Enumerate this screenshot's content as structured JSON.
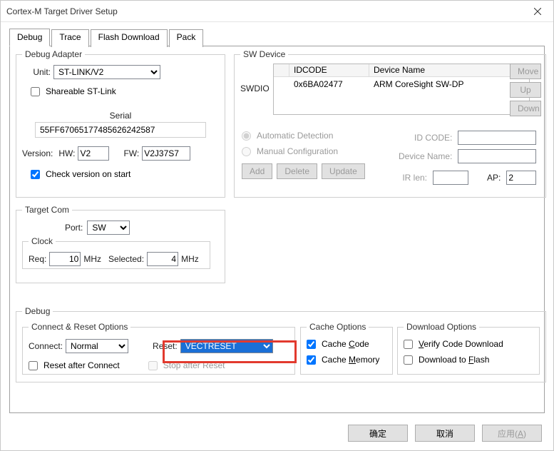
{
  "window": {
    "title": "Cortex-M Target Driver Setup"
  },
  "tabs": {
    "debug": "Debug",
    "trace": "Trace",
    "flash": "Flash Download",
    "pack": "Pack"
  },
  "adapter": {
    "legend": "Debug Adapter",
    "unit_label": "Unit:",
    "unit_value": "ST-LINK/V2",
    "shareable": "Shareable ST-Link",
    "serial_label": "Serial",
    "serial_value": "55FF67065177485626242587",
    "version_label": "Version:",
    "hw_label": "HW:",
    "hw_value": "V2",
    "fw_label": "FW:",
    "fw_value": "V2J37S7",
    "check_version": "Check version on start"
  },
  "target": {
    "legend": "Target Com",
    "port_label": "Port:",
    "port_value": "SW",
    "clock_legend": "Clock",
    "req_label": "Req:",
    "req_value": "10",
    "req_unit": "MHz",
    "sel_label": "Selected:",
    "sel_value": "4",
    "sel_unit": "MHz"
  },
  "sw": {
    "legend": "SW Device",
    "col_idcode": "IDCODE",
    "col_devname": "Device Name",
    "swdio_label": "SWDIO",
    "row_idcode": "0x6BA02477",
    "row_devname": "ARM CoreSight SW-DP",
    "btn_move": "Move",
    "btn_up": "Up",
    "btn_down": "Down",
    "auto": "Automatic Detection",
    "manual": "Manual Configuration",
    "idcode_label": "ID CODE:",
    "devname_label": "Device Name:",
    "irlen_label": "IR len:",
    "btn_add": "Add",
    "btn_delete": "Delete",
    "btn_update": "Update",
    "ap_label": "AP:",
    "ap_value": "2"
  },
  "debug": {
    "legend": "Debug",
    "connect_legend": "Connect & Reset Options",
    "connect_label": "Connect:",
    "connect_value": "Normal",
    "reset_label": "Reset:",
    "reset_value": "VECTRESET",
    "reset_after": "Reset after Connect",
    "stop_after": "Stop after Reset",
    "cache_legend": "Cache Options",
    "cache_code": "Cache Code",
    "cache_mem": "Cache Memory",
    "download_legend": "Download Options",
    "verify": "Verify Code Download",
    "to_flash": "Download to Flash"
  },
  "buttons": {
    "ok": "确定",
    "cancel": "取消",
    "apply": "应用(A)"
  }
}
